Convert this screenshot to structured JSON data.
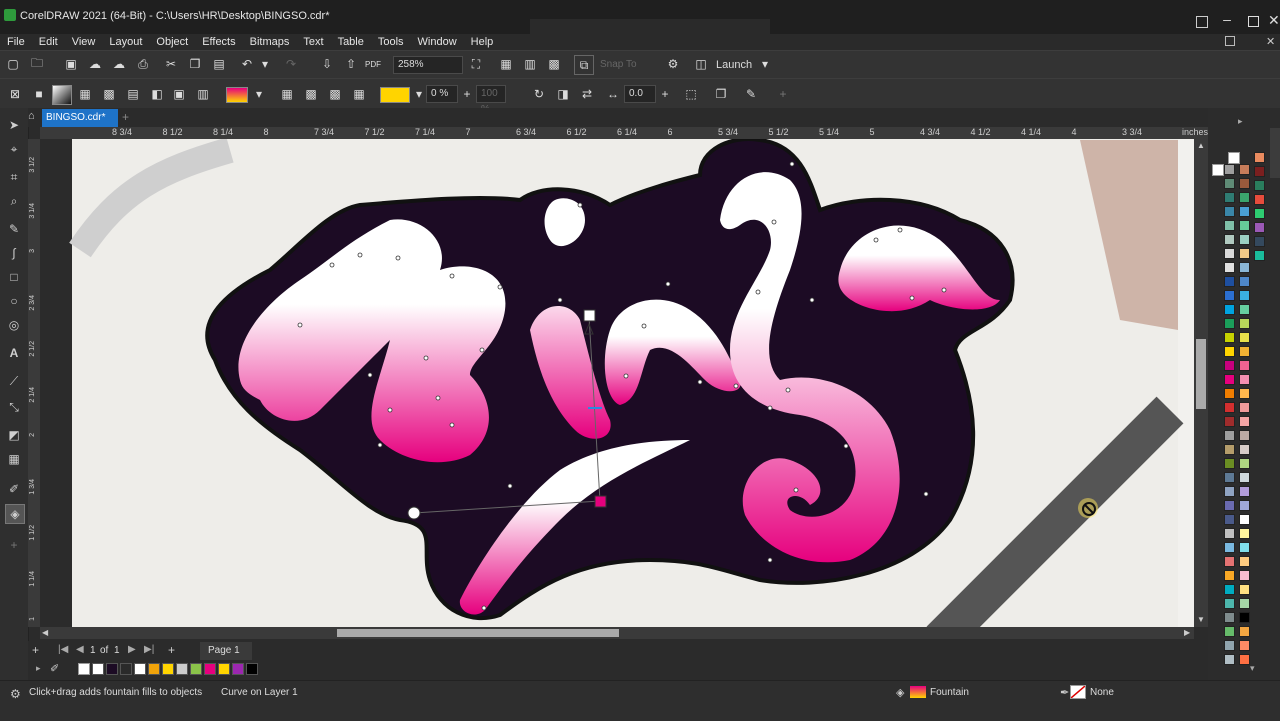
{
  "window": {
    "title": "CorelDRAW 2021 (64-Bit) - C:\\Users\\HR\\Desktop\\BINGSO.cdr*",
    "controls": [
      "minimize",
      "restore",
      "close"
    ]
  },
  "menu": {
    "items": [
      "File",
      "Edit",
      "View",
      "Layout",
      "Object",
      "Effects",
      "Bitmaps",
      "Text",
      "Table",
      "Tools",
      "Window",
      "Help"
    ]
  },
  "standard_toolbar": {
    "zoom_value": "258%",
    "snap_to_label": "Snap To",
    "launch_label": "Launch"
  },
  "property_bar": {
    "fill_color": "#ffd400",
    "transparency_value": "0 %",
    "transparency_disabled_value": "100 %",
    "offset_value": "0.0"
  },
  "document_tab": {
    "name": "BINGSO.cdr*"
  },
  "ruler": {
    "unit": "inches",
    "h_ticks": [
      "8 3/4",
      "8 1/2",
      "8 1/4",
      "8",
      "7 3/4",
      "7 1/2",
      "7 1/4",
      "7",
      "6 3/4",
      "6 1/2",
      "6 1/4",
      "6",
      "5 3/4",
      "5 1/2",
      "5 1/4",
      "5",
      "4 3/4",
      "4 1/2",
      "4 1/4",
      "4",
      "3 3/4"
    ],
    "v_ticks": [
      "3 1/2",
      "3 1/4",
      "3",
      "2 3/4",
      "2 1/2",
      "2 1/4",
      "2",
      "1 3/4",
      "1 1/2",
      "1 1/4",
      "1"
    ]
  },
  "page_nav": {
    "current": "1",
    "of_label": "of",
    "total": "1",
    "page_tab": "Page 1"
  },
  "document_palette": {
    "colors": [
      "#ffffff",
      "#1c0b24",
      "#2a2a2a",
      "#ffffff",
      "#f0a30a",
      "#ffd400",
      "#cccccc",
      "#8bc34a",
      "#e6007e",
      "#ffd400",
      "#9c27b0",
      "#000000"
    ]
  },
  "color_palette": {
    "col1": [
      "#9e9e9e",
      "#5f8b76",
      "#2f7c73",
      "#3a86a8",
      "#7fbfa8",
      "#b0c9c0",
      "#d9d9d9",
      "#e0e0e0",
      "#1e4fa0",
      "#2b6fd1",
      "#00a3e0",
      "#1b9e5a",
      "#c6d200",
      "#ffd400",
      "#c7007d",
      "#e6007e",
      "#ef7d00",
      "#d32f2f",
      "#a02c2c",
      "#9e9e9e",
      "#b59d6b",
      "#6b8e23",
      "#5e7a95",
      "#8fa3c2",
      "#6a6ab0",
      "#4a5a8a",
      "#c0c0c0",
      "#7ab9e0",
      "#e57373",
      "#f9a825",
      "#00acc1",
      "#4db6ac",
      "#7f8c8d",
      "#66bb6a",
      "#90a4ae",
      "#b0bec5"
    ],
    "col2": [
      "#c77c5a",
      "#9b5a3c",
      "#3ba56d",
      "#4aa0d4",
      "#66cc99",
      "#9ad0c2",
      "#f0c987",
      "#8ab6d6",
      "#4e87c9",
      "#3ab0e2",
      "#66d0a0",
      "#b7d65a",
      "#e8e04a",
      "#f2b233",
      "#f06292",
      "#f48fb1",
      "#ffb74d",
      "#ef9a9a",
      "#f5a6a6",
      "#bcaaa4",
      "#d7ccc8",
      "#aed581",
      "#cfd8dc",
      "#b39ddb",
      "#9fa8da",
      "#ffffff",
      "#fff59d",
      "#80deea",
      "#ffcc80",
      "#f8bbd0",
      "#ffe082",
      "#a5d6a7",
      "#000000",
      "#f4a742",
      "#ff8a65",
      "#ff7043"
    ],
    "col3": [
      "#e98b5f",
      "#7b1f1f",
      "#2a7d5d",
      "#e74c3c",
      "#2ecc71",
      "#9b59b6",
      "#34495e",
      "#1abc9c"
    ]
  },
  "canvas": {
    "artwork_text": "Bingo",
    "background_color": "#f2f1ee",
    "outline_color": "#1c0b24",
    "gradient_top": "#ffffff",
    "gradient_bottom": "#e6007e",
    "outline_offset_color": "#111111"
  },
  "status": {
    "hint": "Click+drag adds fountain fills to objects",
    "object_info": "Curve on Layer 1",
    "fill_label": "Fountain",
    "outline_label": "None"
  },
  "icons": {
    "pick_tool": "arrow-cursor-icon",
    "shape_tool": "node-edit-icon",
    "crop_tool": "crop-icon",
    "zoom_tool": "magnifier-icon",
    "freehand_tool": "freehand-icon",
    "artistic_media_tool": "brush-icon",
    "rectangle_tool": "rectangle-icon",
    "ellipse_tool": "ellipse-icon",
    "polygon_tool": "polygon-icon",
    "text_tool": "text-icon",
    "parallel_dimension_tool": "dimension-icon",
    "connector_tool": "connector-icon",
    "drop_shadow_tool": "shadow-icon",
    "transparency_tool": "checker-icon",
    "eyedropper_tool": "eyedropper-icon",
    "interactive_fill_tool": "fill-bucket-icon",
    "add_tool": "plus-icon"
  }
}
